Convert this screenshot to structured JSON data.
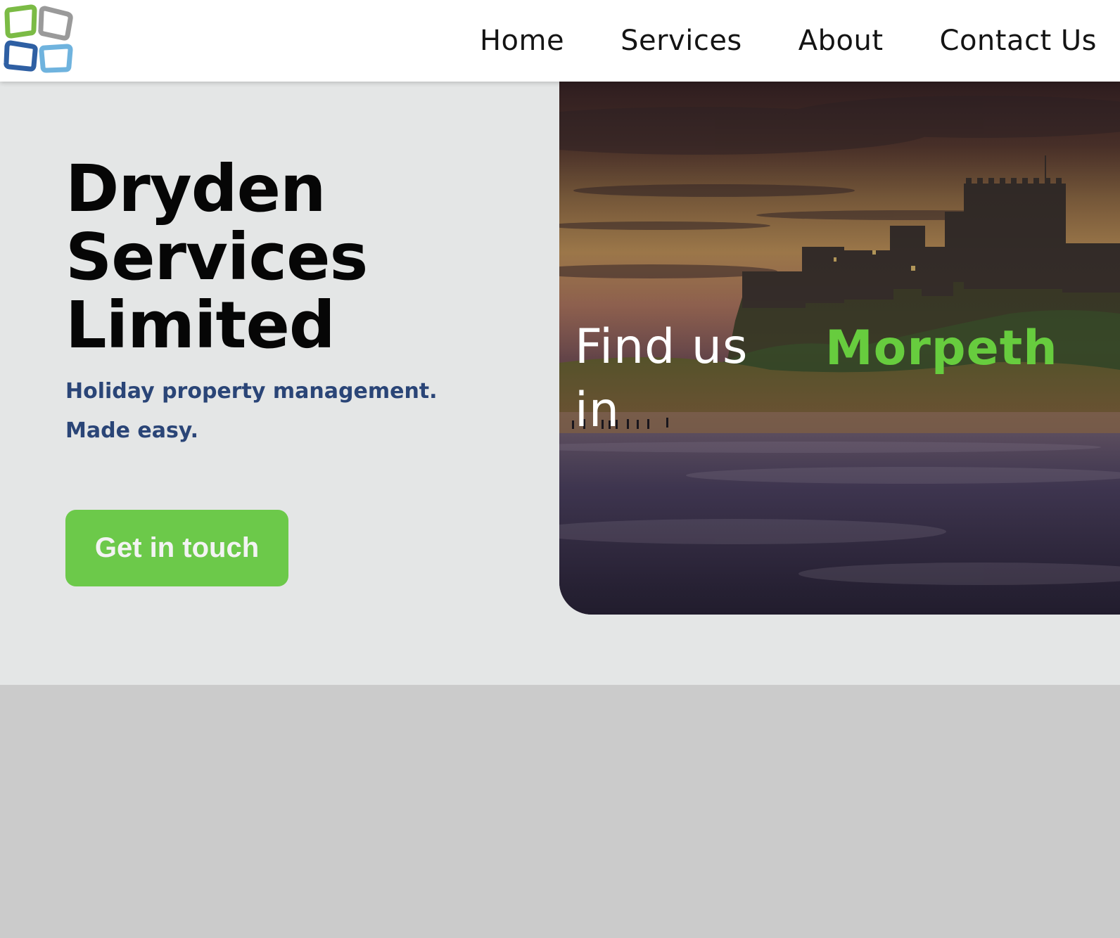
{
  "header": {
    "logo_icon": "four-tile-logo-icon",
    "nav": [
      {
        "label": "Home"
      },
      {
        "label": "Services"
      },
      {
        "label": "About"
      },
      {
        "label": "Contact Us"
      }
    ]
  },
  "hero": {
    "title_lines": [
      "Dryden",
      "Services",
      "Limited"
    ],
    "tagline_lines": [
      "Holiday property management.",
      "Made easy."
    ],
    "cta_label": "Get in touch",
    "image": {
      "subject": "castle-on-hill-over-beach-at-sunset",
      "caption_prefix": "Find us in",
      "caption_city": "Morpeth"
    }
  },
  "colors": {
    "header_bg": "#ffffff",
    "hero_bg": "#e4e6e6",
    "page_bg": "#cbcbcb",
    "title": "#060606",
    "tagline": "#2a4577",
    "accent_green": "#6cc94a",
    "city_green": "#67cc3e",
    "logo_green": "#7bbb45",
    "logo_grey": "#9a9a9a",
    "logo_blue": "#2e5fa3",
    "logo_light_blue": "#6fb3de"
  }
}
